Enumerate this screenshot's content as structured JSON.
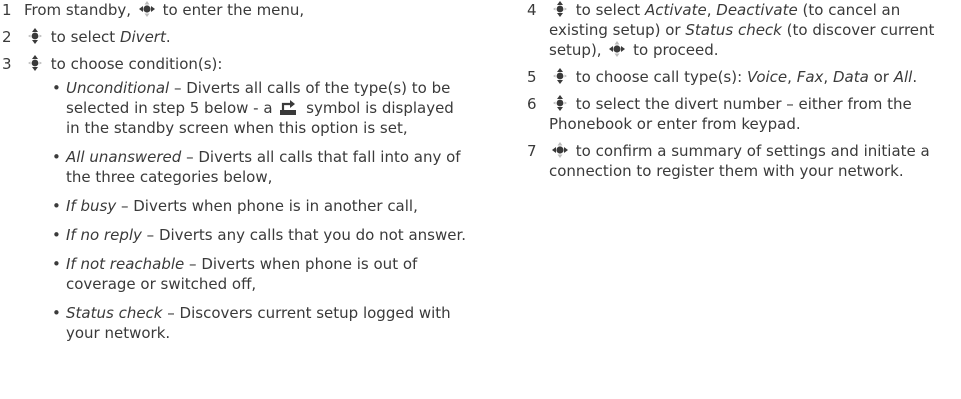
{
  "left_steps": [
    {
      "num": "1",
      "text_a": "From standby,",
      "icon": "joystick-select-icon",
      "text_b": "to enter the menu,"
    },
    {
      "num": "2",
      "icon": "joystick-updown-icon",
      "text_a": "to select",
      "term": "Divert",
      "text_b": "."
    },
    {
      "num": "3",
      "icon": "joystick-updown-icon",
      "text_a": "to choose condition(s):"
    }
  ],
  "bullets": [
    {
      "term": "Unconditional",
      "pre": "– Diverts all calls of the type(s) to be selected in step 5 below - a",
      "symbol": "divert-arrow-icon",
      "post": "symbol is displayed in the standby screen when this option is set,"
    },
    {
      "term": "All unanswered",
      "desc": "– Diverts all calls that fall into any of the three categories below,"
    },
    {
      "term": "If busy",
      "desc": "– Diverts when phone is in another call,"
    },
    {
      "term": "If no reply",
      "desc": "– Diverts any calls that you do not answer."
    },
    {
      "term": "If not reachable",
      "desc": "– Diverts when phone is out of coverage or switched off,"
    },
    {
      "term": "Status check",
      "desc": "– Discovers current setup logged with your network."
    }
  ],
  "right_steps": [
    {
      "num": "4",
      "a": "to select",
      "t1": "Activate",
      "s1": ",",
      "t2": "Deactivate",
      "b": "(to cancel an existing setup) or",
      "t3": "Status check",
      "c": "(to discover current setup),",
      "d": "to proceed."
    },
    {
      "num": "5",
      "a": "to choose call type(s):",
      "t1": "Voice",
      "s1": ",",
      "t2": "Fax",
      "s2": ",",
      "t3": "Data",
      "or": "or",
      "t4": "All",
      "end": "."
    },
    {
      "num": "6",
      "a": "to select the divert number – either from the Phonebook or enter from keypad."
    },
    {
      "num": "7",
      "a": "to confirm a summary of settings and initiate a connection to register them with your network."
    }
  ]
}
